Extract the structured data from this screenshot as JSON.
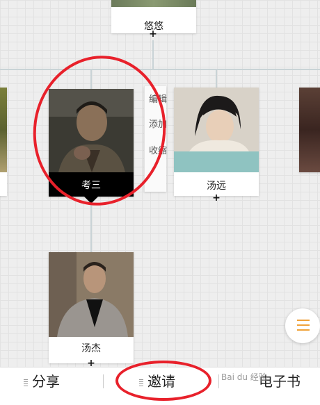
{
  "tree": {
    "top_node": {
      "name": "悠悠"
    },
    "selected_node": {
      "name": "考三"
    },
    "sibling_node": {
      "name": "汤远"
    },
    "child_node": {
      "name": "汤杰"
    },
    "plus_symbol": "+"
  },
  "context_menu": {
    "items": [
      "编辑",
      "添加",
      "收缩"
    ]
  },
  "bottom_bar": {
    "share_label": "分享",
    "invite_label": "邀请",
    "ebook_label": "电子书"
  },
  "watermark": "Bai du 经验",
  "colors": {
    "annotation": "#e8212b",
    "menu_accent": "#f0a23a",
    "selected_card": "#000000",
    "photo_band_teal": "#8fc3c1"
  }
}
